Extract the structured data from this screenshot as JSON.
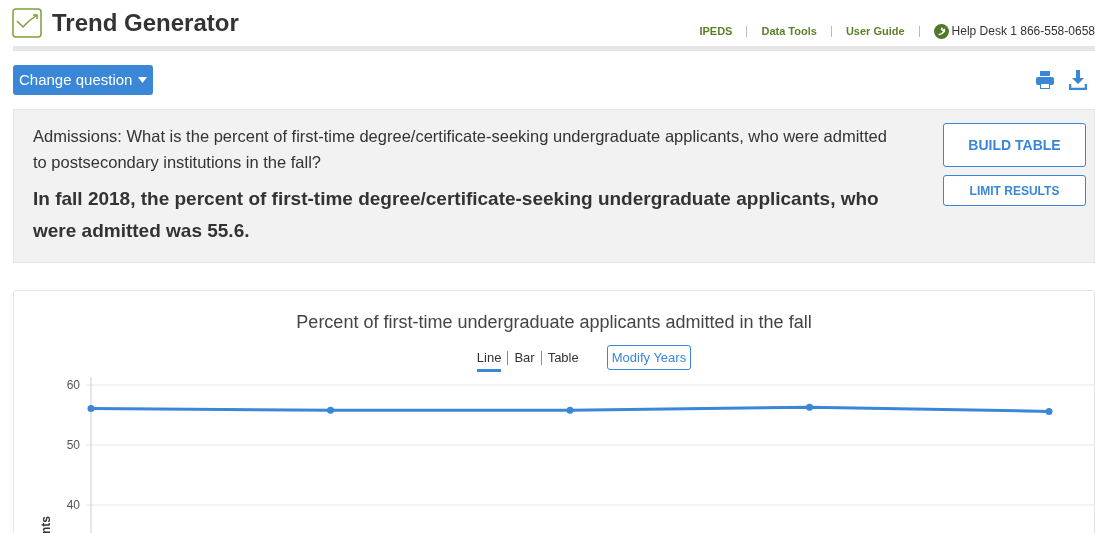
{
  "header": {
    "title": "Trend Generator",
    "links": [
      "IPEDS",
      "Data Tools",
      "User Guide"
    ],
    "help_desk": "Help Desk 1 866-558-0658"
  },
  "change_question": "Change question",
  "question": {
    "text": "Admissions: What is the percent of first-time degree/certificate-seeking undergraduate applicants, who were admitted to postsecondary institutions in the fall?",
    "answer": "In fall 2018, the percent of first-time degree/certificate-seeking undergraduate applicants, who were admitted was 55.6.",
    "buttons": [
      "BUILD TABLE",
      "LIMIT RESULTS"
    ]
  },
  "chart": {
    "title": "Percent of first-time undergraduate applicants admitted in the fall",
    "views": [
      {
        "label": "Line",
        "selected": true
      },
      {
        "label": "Bar",
        "selected": false
      },
      {
        "label": "Table",
        "selected": false
      }
    ],
    "modify": "Modify Years",
    "chart_data": {
      "type": "line",
      "ylabel": "nts",
      "ylim": [
        35,
        60
      ],
      "yticks": [
        40,
        50,
        60
      ],
      "series": [
        {
          "color": "#3a87d8",
          "marker": "circle",
          "values": [
            56.1,
            55.8,
            55.8,
            56.3,
            55.6
          ]
        }
      ]
    }
  }
}
